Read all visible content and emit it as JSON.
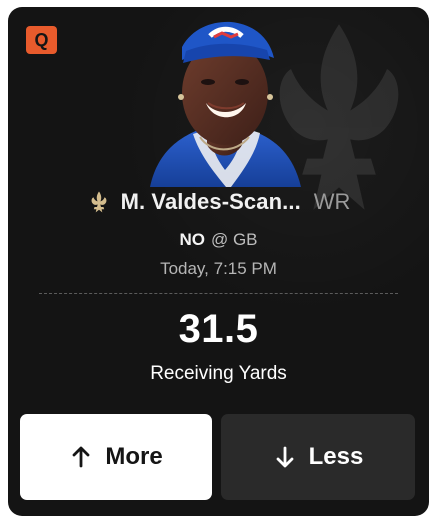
{
  "card": {
    "status_badge": "Q",
    "player": {
      "name": "M. Valdes-Scan...",
      "position": "WR",
      "team_logo_icon": "fleur-de-lis-icon",
      "photo_icon": "player-headshot-icon"
    },
    "matchup": {
      "team": "NO",
      "opponent": "@ GB"
    },
    "game_time": "Today, 7:15 PM",
    "line": {
      "value": "31.5",
      "stat": "Receiving Yards"
    },
    "buttons": {
      "more": {
        "label": "More",
        "icon": "arrow-up-icon"
      },
      "less": {
        "label": "Less",
        "icon": "arrow-down-icon"
      }
    }
  },
  "colors": {
    "card_background": "#141414",
    "badge_orange": "#e85b2c",
    "team_gold": "#d3bc8d",
    "jersey_blue": "#1f4bb3",
    "more_button_background": "#ffffff",
    "less_button_background": "#2a2a2a"
  }
}
